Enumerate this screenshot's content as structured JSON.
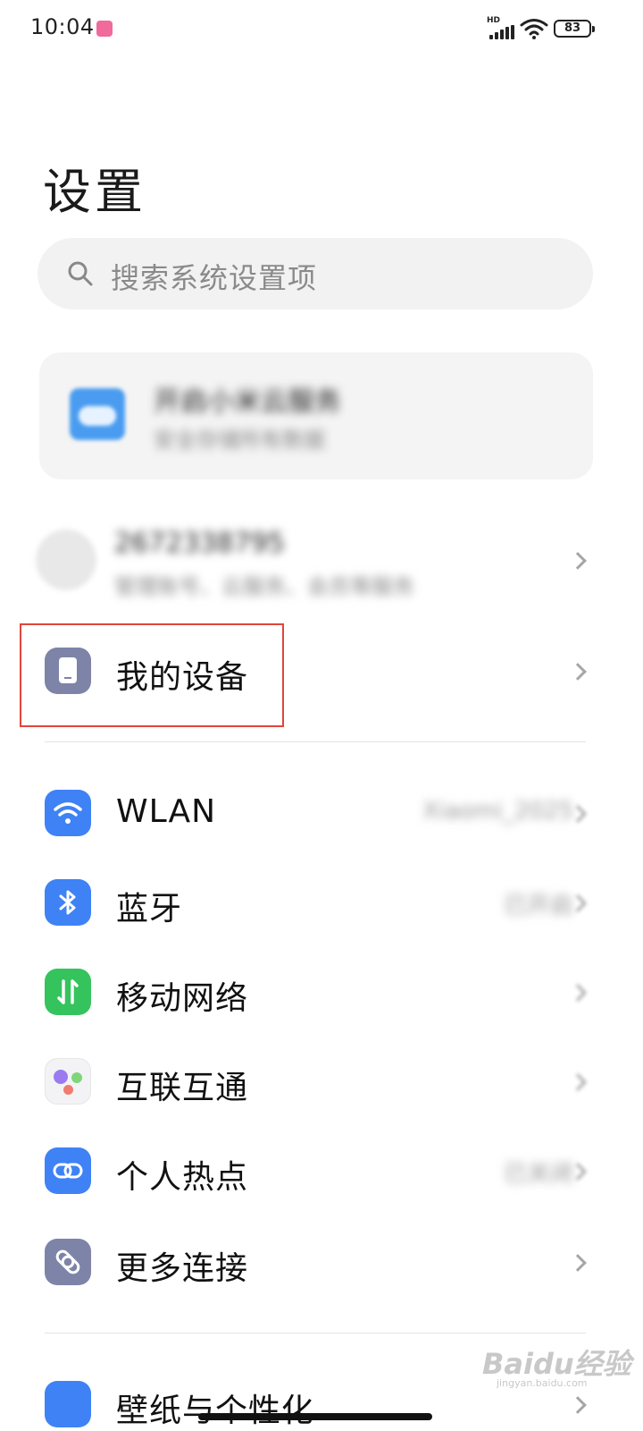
{
  "status_bar": {
    "time": "10:04",
    "network_label": "HD",
    "battery": "83"
  },
  "page": {
    "title": "设置"
  },
  "search": {
    "placeholder": "搜索系统设置项"
  },
  "cloud_card": {
    "title": "开启小米云服务",
    "subtitle": "安全存储所有数据"
  },
  "account": {
    "id": "2672338795",
    "description": "管理账号、云服务、会员等服务"
  },
  "highlight_color": "#e0453a",
  "items": [
    {
      "label": "我的设备",
      "value": "",
      "icon": "device-icon",
      "color": "#7d84a8"
    },
    {
      "label": "WLAN",
      "value": "Xiaomi_2025",
      "icon": "wifi-icon",
      "color": "#3f82f5"
    },
    {
      "label": "蓝牙",
      "value": "已开启",
      "icon": "bluetooth-icon",
      "color": "#3f82f5"
    },
    {
      "label": "移动网络",
      "value": "",
      "icon": "mobile-network-icon",
      "color": "#35c35d"
    },
    {
      "label": "互联互通",
      "value": "",
      "icon": "interconnect-icon",
      "color": "#f3f3f5"
    },
    {
      "label": "个人热点",
      "value": "已关闭",
      "icon": "hotspot-icon",
      "color": "#3f82f5"
    },
    {
      "label": "更多连接",
      "value": "",
      "icon": "link-icon",
      "color": "#7d84a8"
    },
    {
      "label": "壁纸与个性化",
      "value": "",
      "icon": "wallpaper-icon",
      "color": "#3f82f5"
    }
  ],
  "watermark": {
    "brand": "Baidu经验",
    "domain": "jingyan.baidu.com"
  }
}
